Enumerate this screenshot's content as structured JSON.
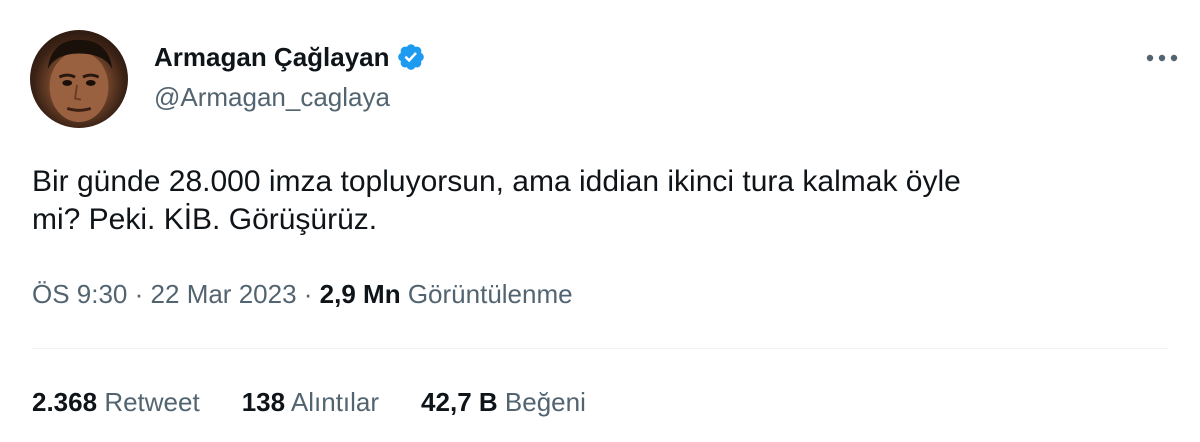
{
  "author": {
    "name": "Armagan Çağlayan",
    "handle": "@Armagan_caglaya",
    "verified": true,
    "verified_color": "#1d9bf0"
  },
  "more_icon": "more-horizontal-icon",
  "tweet": {
    "text": "Bir günde 28.000 imza topluyorsun, ama iddian ikinci tura kalmak öyle\nmi? Peki. KİB. Görüşürüz."
  },
  "meta": {
    "time": "ÖS 9:30",
    "separator": "·",
    "date": "22 Mar 2023",
    "views_count": "2,9 Mn",
    "views_label": "Görüntülenme"
  },
  "stats": {
    "retweets": {
      "count": "2.368",
      "label": "Retweet"
    },
    "quotes": {
      "count": "138",
      "label": "Alıntılar"
    },
    "likes": {
      "count": "42,7 B",
      "label": "Beğeni"
    }
  },
  "colors": {
    "primary_text": "#0f1419",
    "secondary_text": "#536471",
    "divider": "#eff3f4",
    "accent": "#1d9bf0"
  }
}
